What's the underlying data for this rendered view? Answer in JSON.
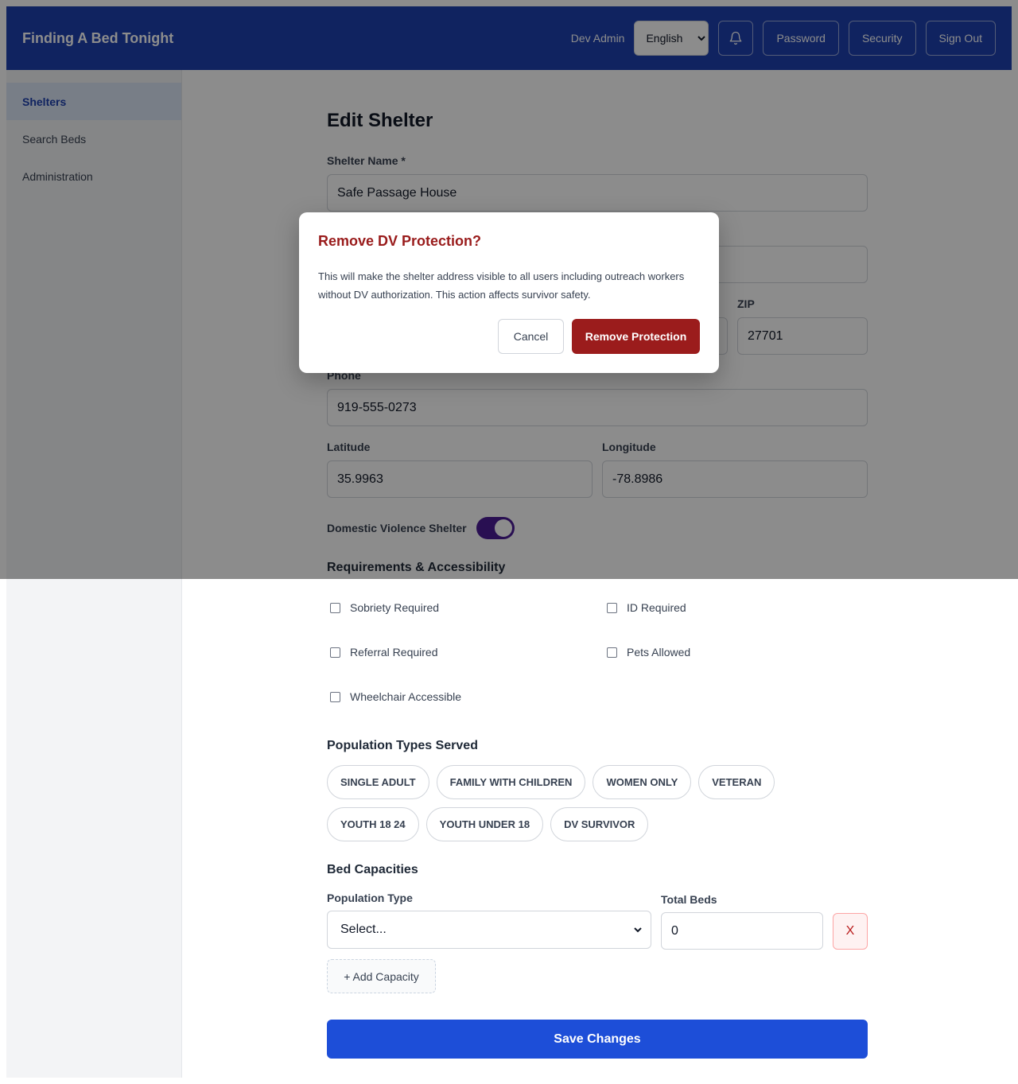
{
  "header": {
    "brand": "Finding A Bed Tonight",
    "user_name": "Dev Admin",
    "language_selected": "English",
    "notification_icon": "bell-icon",
    "password_label": "Password",
    "security_label": "Security",
    "signout_label": "Sign Out"
  },
  "sidebar": {
    "items": [
      {
        "label": "Shelters",
        "active": true
      },
      {
        "label": "Search Beds",
        "active": false
      },
      {
        "label": "Administration",
        "active": false
      }
    ]
  },
  "form": {
    "title": "Edit Shelter",
    "shelter_name_label": "Shelter Name *",
    "shelter_name_value": "Safe Passage House",
    "zip_label": "ZIP",
    "zip_value": "27701",
    "phone_label": "Phone",
    "phone_value": "919-555-0273",
    "latitude_label": "Latitude",
    "latitude_value": "35.9963",
    "longitude_label": "Longitude",
    "longitude_value": "-78.8986",
    "dv_toggle_label": "Domestic Violence Shelter",
    "dv_toggle_on": true,
    "requirements_title": "Requirements & Accessibility",
    "requirements": [
      {
        "label": "Sobriety Required",
        "checked": false
      },
      {
        "label": "ID Required",
        "checked": false
      },
      {
        "label": "Referral Required",
        "checked": false
      },
      {
        "label": "Pets Allowed",
        "checked": false
      },
      {
        "label": "Wheelchair Accessible",
        "checked": false
      }
    ],
    "population_title": "Population Types Served",
    "population_types": [
      "SINGLE ADULT",
      "FAMILY WITH CHILDREN",
      "WOMEN ONLY",
      "VETERAN",
      "YOUTH 18 24",
      "YOUTH UNDER 18",
      "DV SURVIVOR"
    ],
    "bed_capacities_title": "Bed Capacities",
    "population_type_label": "Population Type",
    "population_type_value": "Select...",
    "total_beds_label": "Total Beds",
    "total_beds_value": "0",
    "remove_row_label": "X",
    "add_capacity_label": "+ Add Capacity",
    "save_label": "Save Changes"
  },
  "modal": {
    "title": "Remove DV Protection?",
    "body": "This will make the shelter address visible to all users including outreach workers without DV authorization. This action affects survivor safety.",
    "cancel_label": "Cancel",
    "confirm_label": "Remove Protection"
  },
  "colors": {
    "header_bg": "#1e40af",
    "primary": "#1d4ed8",
    "danger": "#9b1c1c",
    "toggle_on": "#4c1d95"
  }
}
